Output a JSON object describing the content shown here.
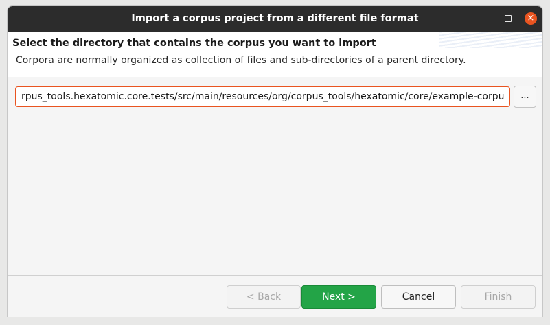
{
  "window": {
    "title": "Import a corpus project from a different file format"
  },
  "header": {
    "title": "Select the directory that contains the corpus you want to import",
    "description": "Corpora are normally organized as collection of files and sub-directories of a parent directory."
  },
  "directory": {
    "value": "rpus_tools.hexatomic.core.tests/src/main/resources/org/corpus_tools/hexatomic/core/example-corpus",
    "browse_label": "..."
  },
  "buttons": {
    "back": "< Back",
    "next": "Next >",
    "cancel": "Cancel",
    "finish": "Finish"
  },
  "titlebar_controls": {
    "close_glyph": "×"
  },
  "colors": {
    "accent": "#e95420",
    "primary_button": "#23a447",
    "titlebar": "#2c2c2c"
  }
}
